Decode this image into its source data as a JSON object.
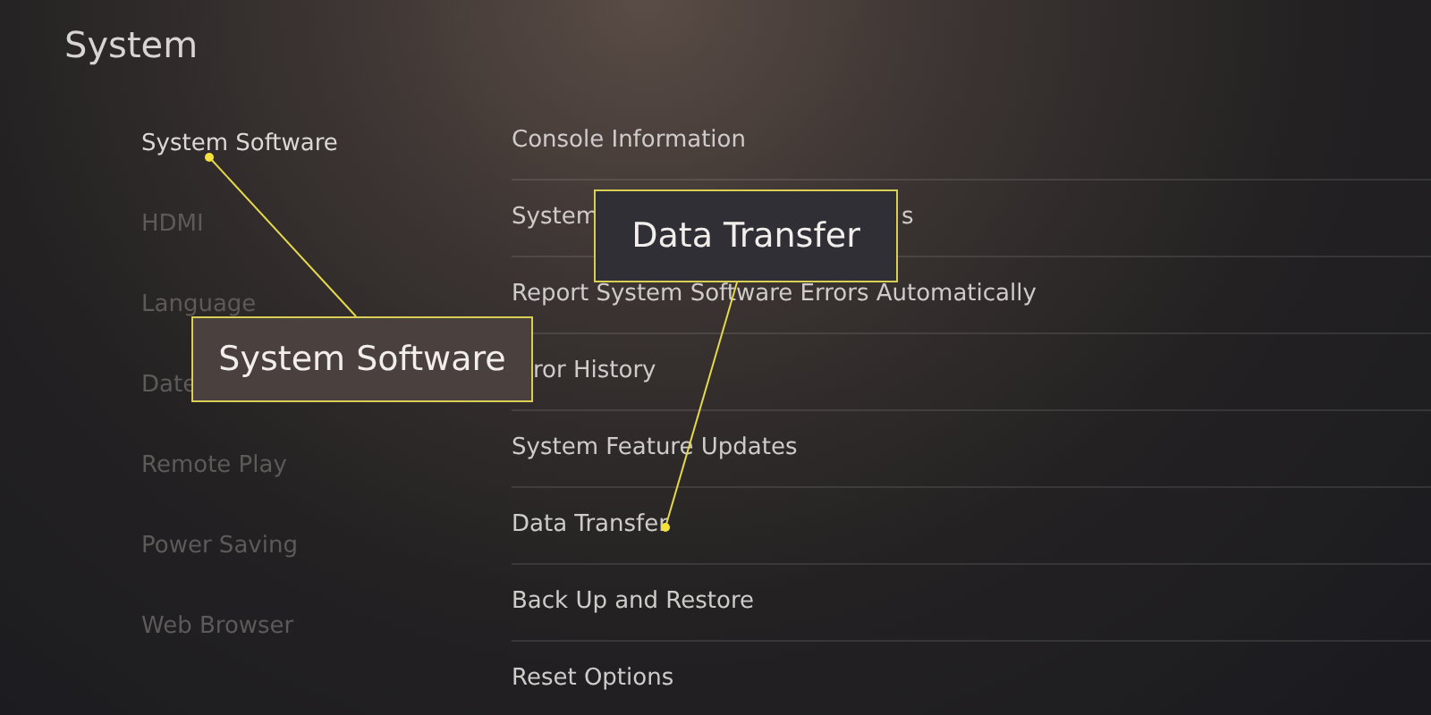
{
  "title": "System",
  "categories": [
    {
      "label": "System Software",
      "selected": true
    },
    {
      "label": "HDMI",
      "selected": false
    },
    {
      "label": "Language",
      "selected": false
    },
    {
      "label": "Date",
      "selected": false
    },
    {
      "label": "Remote Play",
      "selected": false
    },
    {
      "label": "Power Saving",
      "selected": false
    },
    {
      "label": "Web Browser",
      "selected": false
    }
  ],
  "options": [
    {
      "label": "Console Information"
    },
    {
      "label": "System",
      "tail": "s"
    },
    {
      "label": "Report System Software Errors Automatically"
    },
    {
      "label": "ror History"
    },
    {
      "label": "System Feature Updates"
    },
    {
      "label": "Data Transfer"
    },
    {
      "label": "Back Up and Restore"
    },
    {
      "label": "Reset Options"
    }
  ],
  "callouts": [
    {
      "text": "System Software"
    },
    {
      "text": "Data Transfer"
    }
  ]
}
